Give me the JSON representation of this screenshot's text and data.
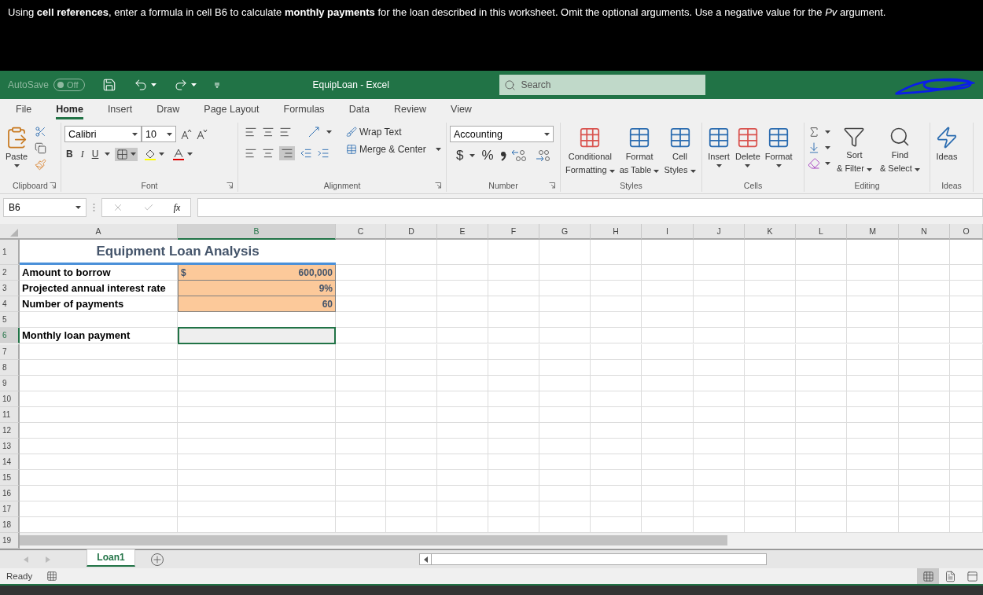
{
  "instruction": "Using **cell references**, enter a formula in cell B6 to calculate **monthly payments** for the loan described in this worksheet. Omit the optional arguments. Use a negative value for the *Pv* argument.",
  "title_bar": {
    "autosave_label": "AutoSave",
    "autosave_state": "Off",
    "autosave_on": false,
    "title": "EquipLoan - Excel",
    "search_placeholder": "Search"
  },
  "ribbon_tabs": [
    {
      "label": "File",
      "selected": false
    },
    {
      "label": "Home",
      "selected": true
    },
    {
      "label": "Insert",
      "selected": false
    },
    {
      "label": "Draw",
      "selected": false
    },
    {
      "label": "Page Layout",
      "selected": false
    },
    {
      "label": "Formulas",
      "selected": false
    },
    {
      "label": "Data",
      "selected": false
    },
    {
      "label": "Review",
      "selected": false
    },
    {
      "label": "View",
      "selected": false
    }
  ],
  "ribbon": {
    "clipboard": {
      "paste": "Paste",
      "label": "Clipboard"
    },
    "font": {
      "name": "Calibri",
      "size": "10",
      "bold": "B",
      "italic": "I",
      "underline": "U",
      "label": "Font"
    },
    "alignment": {
      "wrap": "Wrap Text",
      "merge": "Merge & Center",
      "label": "Alignment"
    },
    "number": {
      "format": "Accounting",
      "currency": "$",
      "percent": "%",
      "label": "Number"
    },
    "styles": {
      "buttons": [
        [
          "Conditional",
          "Formatting"
        ],
        [
          "Format",
          "as Table"
        ],
        [
          "Cell",
          "Styles"
        ]
      ],
      "label": "Styles"
    },
    "cells": {
      "buttons": [
        "Insert",
        "Delete",
        "Format"
      ],
      "label": "Cells"
    },
    "editing": {
      "sort": [
        "Sort",
        "& Filter"
      ],
      "find": [
        "Find",
        "& Select"
      ],
      "label": "Editing"
    },
    "ideas": {
      "button": "Ideas",
      "label": "Ideas"
    }
  },
  "formula_bar": {
    "name_box": "B6",
    "fx": "fx"
  },
  "columns": [
    {
      "label": "A",
      "selected": false
    },
    {
      "label": "B",
      "selected": true
    },
    {
      "label": "C",
      "selected": false
    },
    {
      "label": "D",
      "selected": false
    },
    {
      "label": "E",
      "selected": false
    },
    {
      "label": "F",
      "selected": false
    },
    {
      "label": "G",
      "selected": false
    },
    {
      "label": "H",
      "selected": false
    },
    {
      "label": "I",
      "selected": false
    },
    {
      "label": "J",
      "selected": false
    },
    {
      "label": "K",
      "selected": false
    },
    {
      "label": "L",
      "selected": false
    },
    {
      "label": "M",
      "selected": false
    },
    {
      "label": "N",
      "selected": false
    },
    {
      "label": "O",
      "selected": false
    }
  ],
  "rows": [
    {
      "number": "1",
      "kind": "title",
      "label": "Equipment Loan Analysis",
      "selected": false
    },
    {
      "number": "2",
      "kind": "input",
      "label": "Amount to borrow",
      "currency": "$",
      "value": "600,000",
      "selected": false
    },
    {
      "number": "3",
      "kind": "input",
      "label": "Projected annual interest rate",
      "value": "9%",
      "selected": false
    },
    {
      "number": "4",
      "kind": "input",
      "label": "Number of payments",
      "value": "60",
      "selected": false
    },
    {
      "number": "5",
      "kind": "empty",
      "selected": false
    },
    {
      "number": "6",
      "kind": "result",
      "label": "Monthly loan payment",
      "selected": true
    },
    {
      "number": "7",
      "kind": "empty",
      "selected": false
    },
    {
      "number": "8",
      "kind": "empty",
      "selected": false
    },
    {
      "number": "9",
      "kind": "empty",
      "selected": false
    },
    {
      "number": "10",
      "kind": "empty",
      "selected": false
    },
    {
      "number": "11",
      "kind": "empty",
      "selected": false
    },
    {
      "number": "12",
      "kind": "empty",
      "selected": false
    },
    {
      "number": "13",
      "kind": "empty",
      "selected": false
    },
    {
      "number": "14",
      "kind": "empty",
      "selected": false
    },
    {
      "number": "15",
      "kind": "empty",
      "selected": false
    },
    {
      "number": "16",
      "kind": "empty",
      "selected": false
    },
    {
      "number": "17",
      "kind": "empty",
      "selected": false
    },
    {
      "number": "18",
      "kind": "empty",
      "selected": false
    },
    {
      "number": "19",
      "kind": "scroll",
      "selected": false
    }
  ],
  "sheet_tabs": [
    {
      "label": "Loan1",
      "selected": true
    }
  ],
  "status_bar": {
    "text": "Ready"
  }
}
